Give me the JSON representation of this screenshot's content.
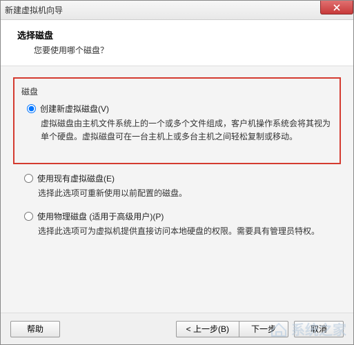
{
  "window": {
    "title": "新建虚拟机向导"
  },
  "header": {
    "title": "选择磁盘",
    "subtitle": "您要使用哪个磁盘？"
  },
  "section": {
    "label": "磁盘"
  },
  "options": {
    "create": {
      "label": "创建新虚拟磁盘(V)",
      "desc": "虚拟磁盘由主机文件系统上的一个或多个文件组成，客户机操作系统会将其视为单个硬盘。虚拟磁盘可在一台主机上或多台主机之间轻松复制或移动。"
    },
    "existing": {
      "label": "使用现有虚拟磁盘(E)",
      "desc": "选择此选项可重新使用以前配置的磁盘。"
    },
    "physical": {
      "label": "使用物理磁盘 (适用于高级用户)(P)",
      "desc": "选择此选项可为虚拟机提供直接访问本地硬盘的权限。需要具有管理员特权。"
    }
  },
  "buttons": {
    "help": "帮助",
    "back": "< 上一步(B)",
    "next": "下一步",
    "cancel": "取消"
  },
  "watermark": {
    "text": "系统之家"
  }
}
